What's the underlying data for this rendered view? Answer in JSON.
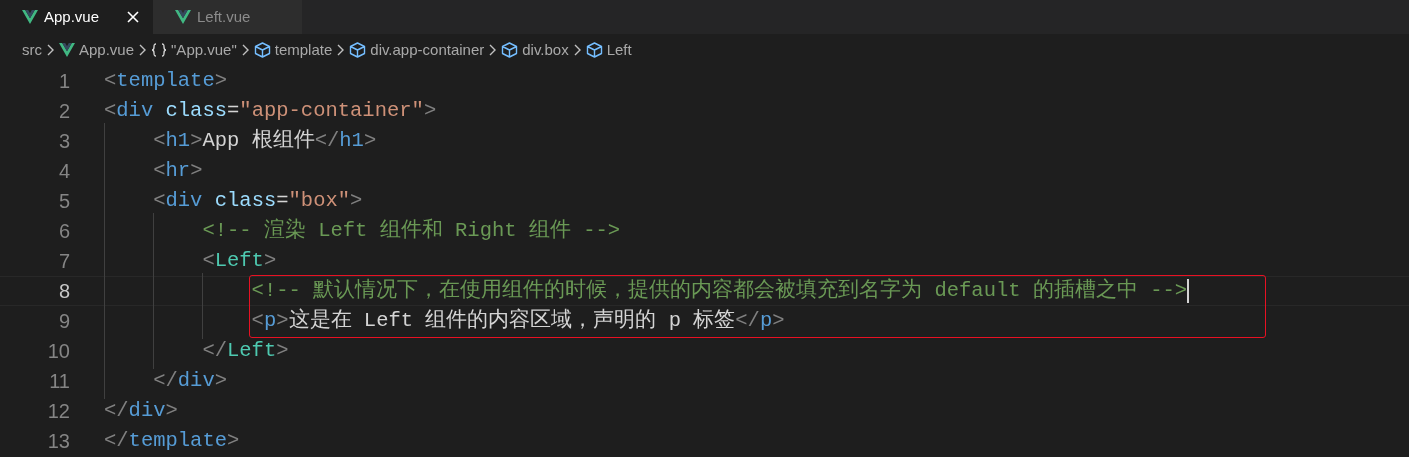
{
  "tabs": [
    {
      "label": "App.vue",
      "selected": true,
      "closable": true
    },
    {
      "label": "Left.vue",
      "selected": false,
      "closable": false
    }
  ],
  "breadcrumbs": [
    {
      "kind": "folder",
      "label": "src"
    },
    {
      "kind": "vue",
      "label": "App.vue"
    },
    {
      "kind": "module",
      "label": "\"App.vue\""
    },
    {
      "kind": "element",
      "label": "template"
    },
    {
      "kind": "element",
      "label": "div.app-container"
    },
    {
      "kind": "element",
      "label": "div.box"
    },
    {
      "kind": "element",
      "label": "Left"
    }
  ],
  "editor": {
    "lines": [
      {
        "number": "1",
        "current": false,
        "boxed": false,
        "tokens": [
          {
            "kind": "punct",
            "text": "<"
          },
          {
            "kind": "tag",
            "text": "template"
          },
          {
            "kind": "punct",
            "text": ">"
          }
        ]
      },
      {
        "number": "2",
        "current": false,
        "boxed": false,
        "tokens": [
          {
            "kind": "punct",
            "text": "<"
          },
          {
            "kind": "tag",
            "text": "div"
          },
          {
            "kind": "attr",
            "text": " class"
          },
          {
            "kind": "text",
            "text": "="
          },
          {
            "kind": "string",
            "text": "\"app-container\""
          },
          {
            "kind": "punct",
            "text": ">"
          }
        ],
        "children": [
          {
            "number": "3",
            "current": false,
            "boxed": false,
            "tokens": [
              {
                "kind": "punct",
                "text": "<"
              },
              {
                "kind": "tag",
                "text": "h1"
              },
              {
                "kind": "punct",
                "text": ">"
              },
              {
                "kind": "text",
                "text": "App 根组件"
              },
              {
                "kind": "punct",
                "text": "</"
              },
              {
                "kind": "tag",
                "text": "h1"
              },
              {
                "kind": "punct",
                "text": ">"
              }
            ]
          },
          {
            "number": "4",
            "current": false,
            "boxed": false,
            "tokens": [
              {
                "kind": "punct",
                "text": "<"
              },
              {
                "kind": "tag",
                "text": "hr"
              },
              {
                "kind": "punct",
                "text": ">"
              }
            ]
          },
          {
            "number": "5",
            "current": false,
            "boxed": false,
            "tokens": [
              {
                "kind": "punct",
                "text": "<"
              },
              {
                "kind": "tag",
                "text": "div"
              },
              {
                "kind": "attr",
                "text": " class"
              },
              {
                "kind": "text",
                "text": "="
              },
              {
                "kind": "string",
                "text": "\"box\""
              },
              {
                "kind": "punct",
                "text": ">"
              }
            ],
            "children": [
              {
                "number": "6",
                "current": false,
                "boxed": false,
                "tokens": [
                  {
                    "kind": "comment",
                    "text": "<!-- 渲染 Left 组件和 Right 组件 -->"
                  }
                ]
              },
              {
                "number": "7",
                "current": false,
                "boxed": false,
                "tokens": [
                  {
                    "kind": "punct",
                    "text": "<"
                  },
                  {
                    "kind": "component",
                    "text": "Left"
                  },
                  {
                    "kind": "punct",
                    "text": ">"
                  }
                ],
                "children": [
                  {
                    "number": "8",
                    "current": true,
                    "boxed": true,
                    "tokens": [
                      {
                        "kind": "comment",
                        "text": "<!-- 默认情况下，在使用组件的时候，提供的内容都会被填充到名字为 default 的插槽之中 -->"
                      }
                    ]
                  },
                  {
                    "number": "9",
                    "current": false,
                    "boxed": true,
                    "tokens": [
                      {
                        "kind": "punct",
                        "text": "<"
                      },
                      {
                        "kind": "tag",
                        "text": "p"
                      },
                      {
                        "kind": "punct",
                        "text": ">"
                      },
                      {
                        "kind": "text",
                        "text": "这是在 Left 组件的内容区域，声明的 p 标签"
                      },
                      {
                        "kind": "punct",
                        "text": "</"
                      },
                      {
                        "kind": "tag",
                        "text": "p"
                      },
                      {
                        "kind": "punct",
                        "text": ">"
                      }
                    ]
                  }
                ]
              },
              {
                "number": "10",
                "current": false,
                "boxed": false,
                "tokens": [
                  {
                    "kind": "punct",
                    "text": "</"
                  },
                  {
                    "kind": "component",
                    "text": "Left"
                  },
                  {
                    "kind": "punct",
                    "text": ">"
                  }
                ]
              }
            ]
          },
          {
            "number": "11",
            "current": false,
            "boxed": false,
            "tokens": [
              {
                "kind": "punct",
                "text": "</"
              },
              {
                "kind": "tag",
                "text": "div"
              },
              {
                "kind": "punct",
                "text": ">"
              }
            ]
          }
        ]
      },
      {
        "number": "12",
        "current": false,
        "boxed": false,
        "tokens": [
          {
            "kind": "punct",
            "text": "</"
          },
          {
            "kind": "tag",
            "text": "div"
          },
          {
            "kind": "punct",
            "text": ">"
          }
        ]
      },
      {
        "number": "13",
        "current": false,
        "boxed": false,
        "tokens": [
          {
            "kind": "punct",
            "text": "</"
          },
          {
            "kind": "tag",
            "text": "template"
          },
          {
            "kind": "punct",
            "text": ">"
          }
        ]
      }
    ]
  }
}
